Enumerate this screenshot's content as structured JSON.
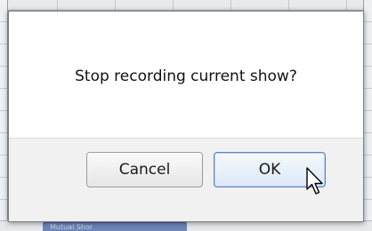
{
  "background": {
    "bottom_tab_label": "Mutual Shor"
  },
  "dialog": {
    "message": "Stop recording current show?",
    "buttons": {
      "cancel_label": "Cancel",
      "ok_label": "OK"
    }
  },
  "cursor": {
    "icon": "arrow-pointer-icon"
  },
  "colors": {
    "dialog_border": "#7c8088",
    "footer_bg": "#f1f1f1",
    "ok_focus_border": "#5b86c2"
  }
}
